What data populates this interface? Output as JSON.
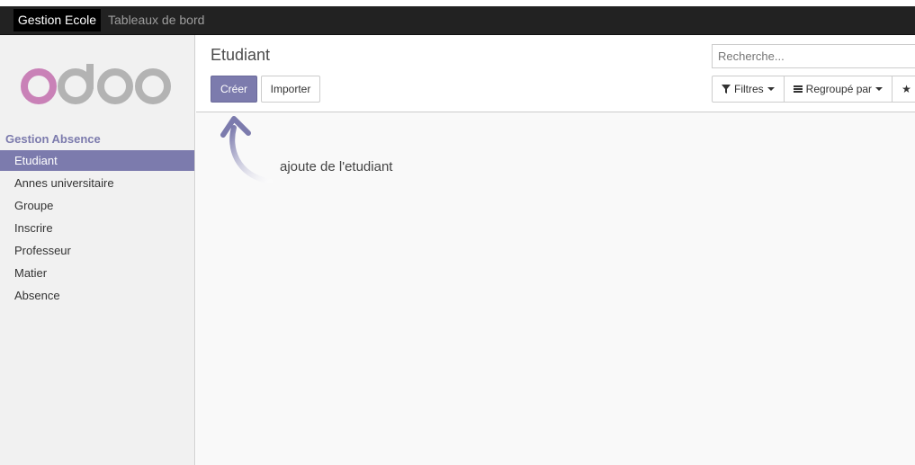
{
  "topbar": {
    "app_name": "Gestion Ecole",
    "nav_item": "Tableaux de bord"
  },
  "sidebar": {
    "logo_text": "odoo",
    "section_title": "Gestion Absence",
    "items": [
      {
        "label": "Etudiant",
        "active": true
      },
      {
        "label": "Annes universitaire"
      },
      {
        "label": "Groupe"
      },
      {
        "label": "Inscrire"
      },
      {
        "label": "Professeur"
      },
      {
        "label": "Matier"
      },
      {
        "label": "Absence"
      }
    ]
  },
  "control_panel": {
    "breadcrumb": "Etudiant",
    "create_label": "Créer",
    "import_label": "Importer",
    "search_placeholder": "Recherche...",
    "filters_label": "Filtres",
    "groupby_label": "Regroupé par",
    "favorites_label": "F"
  },
  "annotation": {
    "text": "ajoute de l'etudiant"
  },
  "colors": {
    "brand": "#7c7bad",
    "topbar": "#222222",
    "logo_o": "#c981b7",
    "logo_grey": "#b3b3b3"
  }
}
